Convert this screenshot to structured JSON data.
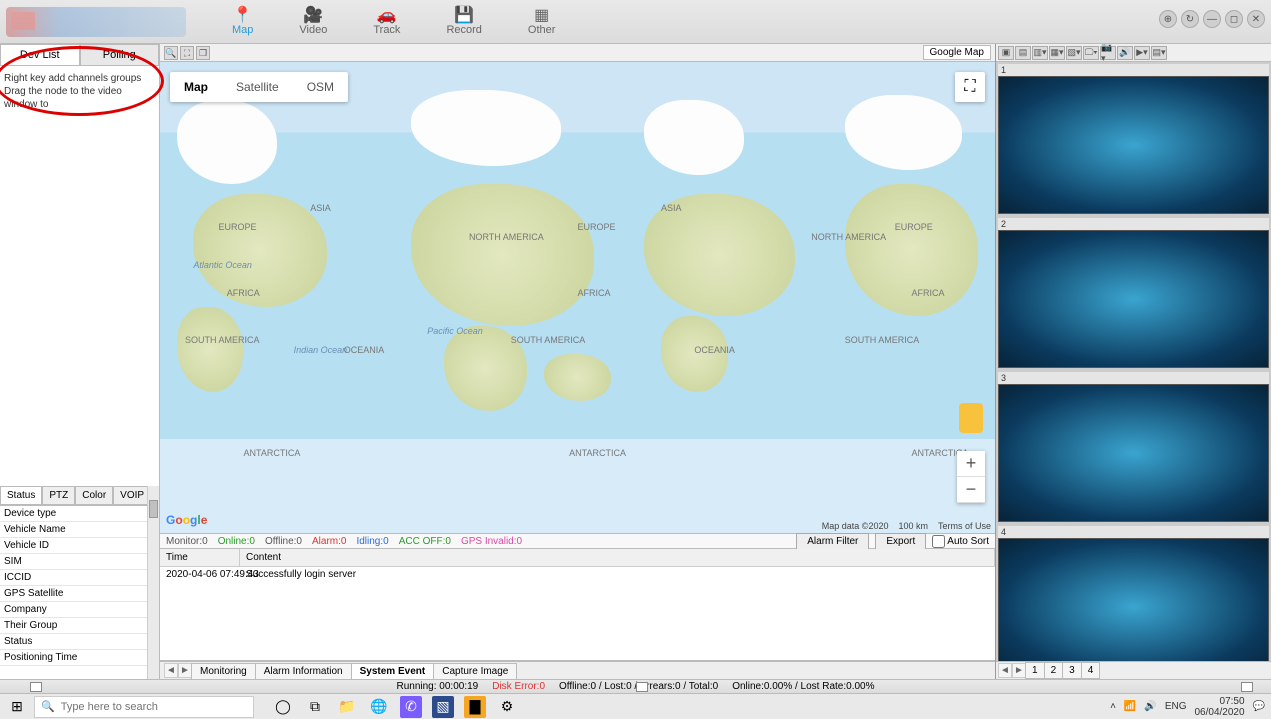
{
  "topnav": [
    "Map",
    "Video",
    "Track",
    "Record",
    "Other"
  ],
  "topnav_icons": [
    "📍",
    "🎥",
    "🚗",
    "💾",
    "▦"
  ],
  "left_tabs": [
    "Dev List",
    "Polling"
  ],
  "left_hint1": "Right key add channels groups",
  "left_hint2": "Drag the node to the video window to",
  "sub_tabs": [
    "Status",
    "PTZ",
    "Color",
    "VOIP"
  ],
  "props": [
    "Device type",
    "Vehicle Name",
    "Vehicle ID",
    "SIM",
    "ICCID",
    "GPS Satellite",
    "Company",
    "Their Group",
    "Status",
    "Positioning Time"
  ],
  "map_modes": [
    "Map",
    "Satellite",
    "OSM"
  ],
  "map_provider": "Google Map",
  "continents": [
    "EUROPE",
    "ASIA",
    "NORTH AMERICA",
    "AFRICA",
    "SOUTH AMERICA",
    "OCEANIA",
    "ANTARCTICA"
  ],
  "oceans": [
    "Atlantic Ocean",
    "Indian Ocean",
    "Pacific Ocean"
  ],
  "map_footer": {
    "data": "Map data ©2020",
    "scale": "100 km",
    "terms": "Terms of Use"
  },
  "status_counters": {
    "monitor": "Monitor:0",
    "online": "Online:0",
    "offline": "Offline:0",
    "alarm": "Alarm:0",
    "idling": "Idling:0",
    "accoff": "ACC OFF:0",
    "gpsinvalid": "GPS Invalid:0"
  },
  "stat_buttons": {
    "alarm_filter": "Alarm Filter",
    "export": "Export",
    "autosort": "Auto Sort"
  },
  "evt_headers": [
    "Time",
    "Content"
  ],
  "evt_rows": [
    [
      "2020-04-06 07:49:43",
      "Successfully login server"
    ]
  ],
  "center_tabs": [
    "Monitoring",
    "Alarm Information",
    "System Event",
    "Capture Image"
  ],
  "right_tabs": [
    "1",
    "2",
    "3",
    "4"
  ],
  "video_slots": [
    "1",
    "2",
    "3",
    "4"
  ],
  "appstatus": {
    "running": "Running: 00:00:19",
    "diskerr": "Disk Error:0",
    "net": "Offline:0 / Lost:0 / Arrears:0 / Total:0",
    "rate": "Online:0.00% / Lost Rate:0.00%"
  },
  "search_placeholder": "Type here to search",
  "tray": {
    "lang": "ENG",
    "time": "07:50",
    "date": "06/04/2020"
  },
  "colors": {
    "active": "#2a9bd6"
  }
}
